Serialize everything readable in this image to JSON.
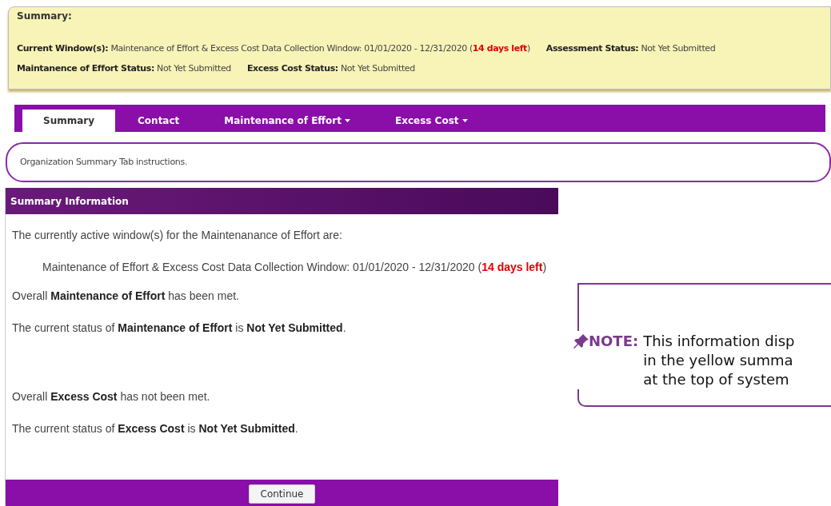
{
  "summary": {
    "title": "Summary:",
    "lines": [
      [
        {
          "label": "Current Window(s):",
          "segments": [
            {
              "text": "Maintenance of Effort & Excess Cost Data Collection Window: 01/01/2020 - 12/31/2020 (",
              "kind": "normal"
            },
            {
              "text": "14 days left",
              "kind": "alert"
            },
            {
              "text": ")",
              "kind": "normal"
            }
          ]
        },
        {
          "label": "Assessment Status:",
          "segments": [
            {
              "text": "Not Yet Submitted",
              "kind": "normal"
            }
          ]
        }
      ],
      [
        {
          "label": "Maintanence of Effort Status:",
          "segments": [
            {
              "text": "Not Yet Submitted",
              "kind": "normal"
            }
          ]
        },
        {
          "label": "Excess Cost Status:",
          "segments": [
            {
              "text": "Not Yet Submitted",
              "kind": "normal"
            }
          ]
        }
      ]
    ]
  },
  "tabs": [
    {
      "label": "Summary",
      "selected": true,
      "dropdown": false
    },
    {
      "label": "Contact",
      "selected": false,
      "dropdown": false
    },
    {
      "label": "Maintenance of Effort",
      "selected": false,
      "dropdown": true
    },
    {
      "label": "Excess Cost",
      "selected": false,
      "dropdown": true
    }
  ],
  "instructions": "Organization Summary Tab instructions.",
  "panel": {
    "title": "Summary Information",
    "sections": [
      [
        {
          "kind": "plain",
          "segments": [
            {
              "text": "The currently active window(s) for the Maintenanance of Effort are:",
              "kind": "normal"
            }
          ]
        },
        {
          "kind": "indented",
          "segments": [
            {
              "text": "Maintenance of Effort & Excess Cost Data Collection Window: 01/01/2020 - 12/31/2020 (",
              "kind": "normal"
            },
            {
              "text": "14 days left",
              "kind": "alert"
            },
            {
              "text": ")",
              "kind": "normal"
            }
          ]
        },
        {
          "kind": "plain",
          "segments": [
            {
              "text": "Overall ",
              "kind": "normal"
            },
            {
              "text": "Maintenance of Effort",
              "kind": "bold"
            },
            {
              "text": " has been met.",
              "kind": "normal"
            }
          ]
        },
        {
          "kind": "plain",
          "segments": [
            {
              "text": "The current status of ",
              "kind": "normal"
            },
            {
              "text": "Maintenance of Effort",
              "kind": "bold"
            },
            {
              "text": " is ",
              "kind": "normal"
            },
            {
              "text": "Not Yet Submitted",
              "kind": "bold"
            },
            {
              "text": ".",
              "kind": "normal"
            }
          ]
        }
      ],
      [
        {
          "kind": "plain",
          "segments": [
            {
              "text": "Overall ",
              "kind": "normal"
            },
            {
              "text": "Excess Cost",
              "kind": "bold"
            },
            {
              "text": " has not been met.",
              "kind": "normal"
            }
          ]
        },
        {
          "kind": "plain",
          "segments": [
            {
              "text": "The current status of ",
              "kind": "normal"
            },
            {
              "text": "Excess Cost",
              "kind": "bold"
            },
            {
              "text": " is ",
              "kind": "normal"
            },
            {
              "text": "Not Yet Submitted",
              "kind": "bold"
            },
            {
              "text": ".",
              "kind": "normal"
            }
          ]
        }
      ]
    ],
    "button": "Continue"
  },
  "note": {
    "label": "NOTE:",
    "lines": [
      "This information disp",
      "in the yellow summa",
      "at the top of system"
    ]
  }
}
